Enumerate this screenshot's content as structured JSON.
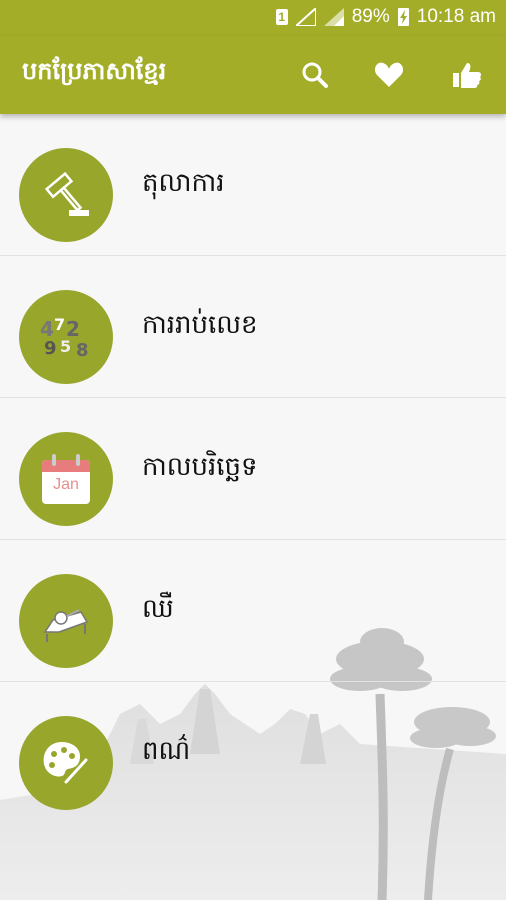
{
  "status": {
    "battery": "89%",
    "time": "10:18 am",
    "sim": "1"
  },
  "app": {
    "title": "បកប្រែភាសាខ្មែរ"
  },
  "categories": [
    {
      "label": "តុលាការ",
      "icon": "gavel-icon"
    },
    {
      "label": "ការរាប់លេខ",
      "icon": "numbers-icon"
    },
    {
      "label": "កាលបរិច្ឆេទ",
      "icon": "calendar-icon",
      "icon_text": "Jan"
    },
    {
      "label": "ឈឺ",
      "icon": "sick-bed-icon"
    },
    {
      "label": "ពណ៌",
      "icon": "palette-icon"
    }
  ],
  "colors": {
    "accent": "#a3ad28",
    "circle": "#98a62c"
  }
}
